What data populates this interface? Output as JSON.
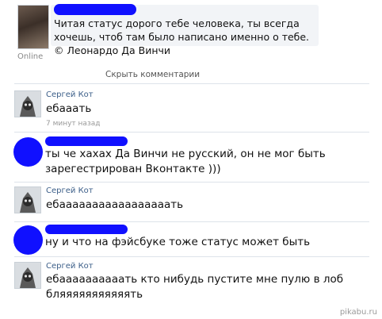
{
  "status": {
    "online_label": "Online",
    "text": "Читая статус дорого тебе человека, ты всегда хочешь, чтоб там было написано именно о тебе. © Леонардо Да Винчи",
    "hide_comments": "Скрыть комментарии"
  },
  "comments": [
    {
      "author": "Сергей Кот",
      "text": "ебааать",
      "time": "7 минут назад"
    },
    {
      "author": "",
      "text": "ты че хахах Да Винчи не русский, он не мог быть зарегестрирован Вконтакте )))"
    },
    {
      "author": "Сергей Кот",
      "text": "ебааааааааааааааааать"
    },
    {
      "author": "",
      "text": "ну и что на фэйсбуке тоже статус может быть"
    },
    {
      "author": "Сергей Кот",
      "text": "ебаааааааааать кто нибудь пустите мне пулю в лоб бляяяяяяяяяяять"
    }
  ],
  "watermark": "pikabu.ru",
  "colors": {
    "redaction": "#1010ff",
    "author_link": "#3b5e88"
  }
}
